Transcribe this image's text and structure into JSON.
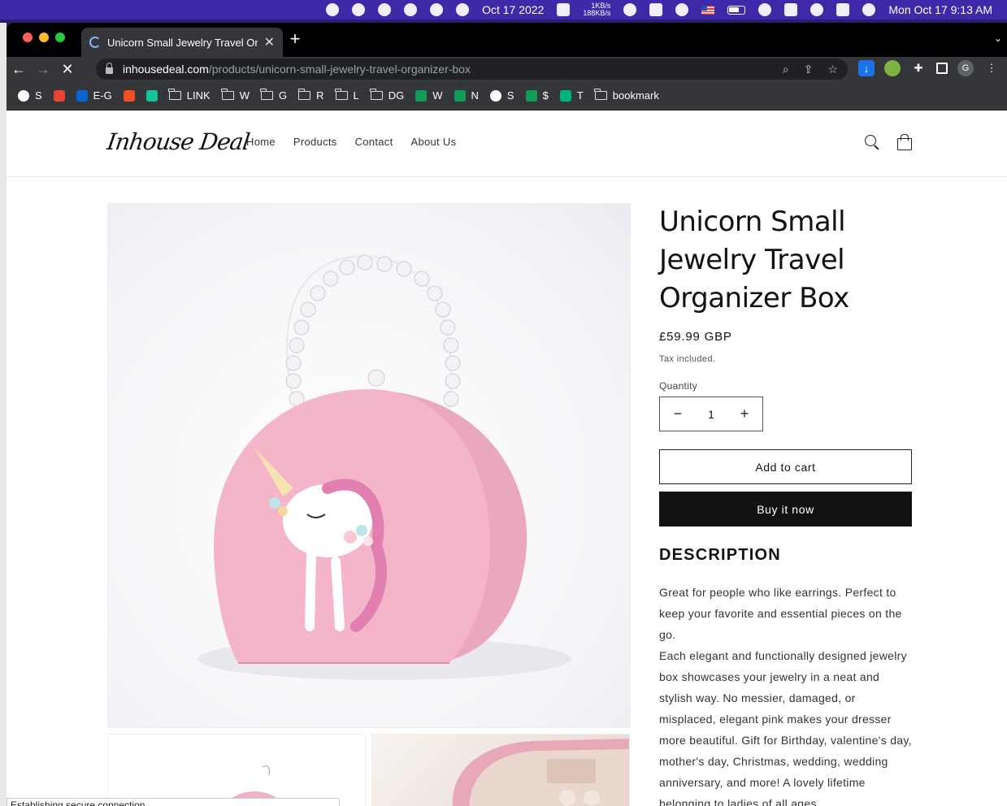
{
  "menubar": {
    "date_text": "Oct 17 2022",
    "net_up": "1KB/s",
    "net_down": "188KB/s",
    "clock": "Mon Oct 17  9:13 AM"
  },
  "browser": {
    "tab_title": "Unicorn Small Jewelry Travel Organizer Box",
    "url_host": "inhousedeal.com",
    "url_path": "/products/unicorn-small-jewelry-travel-organizer-box",
    "profile_initial": "G",
    "bookmarks": [
      {
        "label": "S",
        "icon": "globe-icon",
        "color": "#ffffff"
      },
      {
        "label": "",
        "icon": "gmail-icon",
        "color": "#ea4335"
      },
      {
        "label": "E-G",
        "icon": "outlook-icon",
        "color": "#0a64d0"
      },
      {
        "label": "",
        "icon": "microsoft-icon",
        "color": "#f25022"
      },
      {
        "label": "",
        "icon": "grammarly-icon",
        "color": "#15c39a"
      },
      {
        "label": "LINK",
        "icon": "folder-icon",
        "color": ""
      },
      {
        "label": "W",
        "icon": "folder-icon",
        "color": ""
      },
      {
        "label": "G",
        "icon": "folder-icon",
        "color": ""
      },
      {
        "label": "R",
        "icon": "folder-icon",
        "color": ""
      },
      {
        "label": "L",
        "icon": "folder-icon",
        "color": ""
      },
      {
        "label": "DG",
        "icon": "folder-icon",
        "color": ""
      },
      {
        "label": "W",
        "icon": "sheets-icon",
        "color": "#0f9d58"
      },
      {
        "label": "N",
        "icon": "sheets-icon",
        "color": "#0f9d58"
      },
      {
        "label": "S",
        "icon": "globe-icon",
        "color": "#ffffff"
      },
      {
        "label": "$",
        "icon": "sheets-icon",
        "color": "#0f9d58"
      },
      {
        "label": "T",
        "icon": "star-icon",
        "color": "#00b67a"
      },
      {
        "label": "bookmark",
        "icon": "folder-icon",
        "color": ""
      }
    ],
    "status_text": "Establishing secure connection..."
  },
  "site": {
    "logo": "Inhouse Deal",
    "nav": [
      "Home",
      "Products",
      "Contact",
      "About Us"
    ]
  },
  "product": {
    "title": "Unicorn Small Jewelry Travel Organizer Box",
    "price": "£59.99 GBP",
    "tax_note": "Tax included.",
    "quantity_label": "Quantity",
    "quantity_value": "1",
    "add_to_cart": "Add to cart",
    "buy_now": "Buy it now",
    "description_heading": "DESCRIPTION",
    "description_p1": "Great for people who like earrings. Perfect to keep your favorite and essential pieces on the go.",
    "description_p2": "Each elegant and functionally designed jewelry box showcases your jewelry in a neat and stylish way. No messier, damaged, or misplaced, elegant pink makes your dresser more beautiful. Gift for Birthday, valentine's day, mother's day, Christmas, wedding, wedding anniversary, and more! A lovely lifetime belonging to ladies of all ages."
  }
}
